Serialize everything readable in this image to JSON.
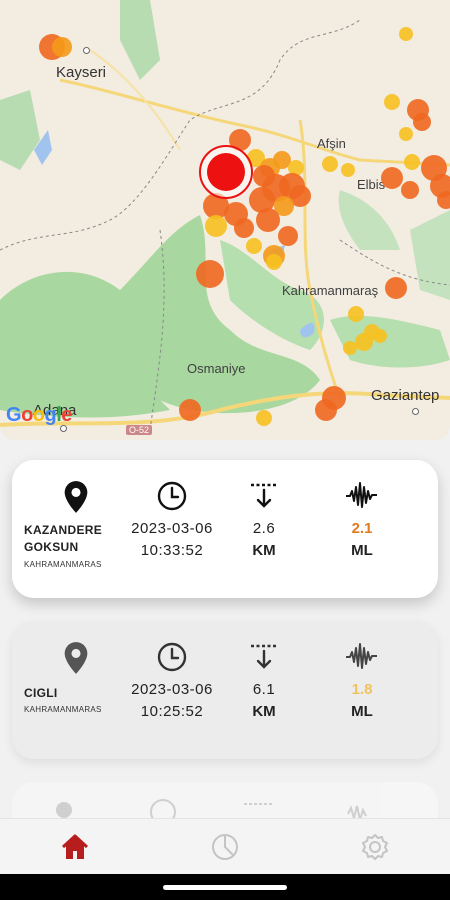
{
  "map": {
    "cities": {
      "kayseri": "Kayseri",
      "afsin": "Afşin",
      "elbistan": "Elbis",
      "kahramanmaras": "Kahramanmaraş",
      "osmaniye": "Osmaniye",
      "adana": "Adana",
      "gaziantep": "Gaziantep"
    },
    "road_label": "O-52",
    "attribution": "Google",
    "colors": {
      "land": "#f2ece1",
      "forest": "#a8d8a0",
      "water": "#a0c4ee",
      "road": "#f5d77a",
      "quake_strong": "#f06820",
      "quake_medium": "#f59a1a",
      "quake_weak": "#f7c120",
      "selected": "#ee1111"
    }
  },
  "cards": [
    {
      "location": [
        "KAZANDERE",
        "GOKSUN"
      ],
      "province": "KAHRAMANMARAS",
      "date": "2023-03-06",
      "time": "10:33:52",
      "depth": "2.6",
      "depth_unit": "KM",
      "magnitude": "2.1",
      "mag_unit": "ML",
      "mag_color": "#e07b1f"
    },
    {
      "location": [
        "CIGLI"
      ],
      "province": "KAHRAMANMARAS",
      "date": "2023-03-06",
      "time": "10:25:52",
      "depth": "6.1",
      "depth_unit": "KM",
      "magnitude": "1.8",
      "mag_unit": "ML",
      "mag_color": "#f2c25a"
    }
  ],
  "nav": {
    "items": [
      "home-icon",
      "history-icon",
      "settings-icon"
    ],
    "active_color": "#b81d1d"
  }
}
